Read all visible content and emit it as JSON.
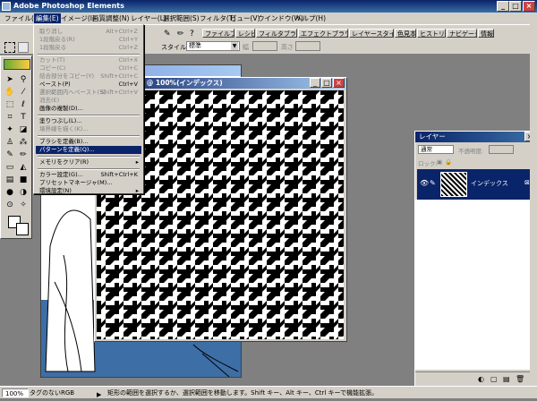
{
  "app": {
    "title": "Adobe Photoshop Elements"
  },
  "window_buttons": {
    "minimize": "_",
    "maximize": "□",
    "close": "×"
  },
  "menubar": [
    "ファイル(F)",
    "編集(E)",
    "イメージ(I)",
    "画質調整(N)",
    "レイヤー(L)",
    "選択範囲(S)",
    "フィルタ(T)",
    "ビュー(V)",
    "ウインドウ(W)",
    "ヘルプ(H)"
  ],
  "options": {
    "style_label": "スタイル",
    "style_value": "標準",
    "width_label": "幅",
    "height_label": "高さ",
    "tabs": [
      "ファイルブラウザ",
      "レシピ",
      "フィルタブラウザ",
      "エフェクトブラウザ",
      "レイヤースタイル",
      "色見本",
      "ヒストリー",
      "ナビゲータ",
      "情報"
    ]
  },
  "edit_menu": {
    "items": [
      {
        "label": "取り消し",
        "shortcut": "Alt+Ctrl+Z",
        "disabled": true
      },
      {
        "label": "1段階戻る(R)",
        "shortcut": "Ctrl+Y",
        "disabled": true
      },
      {
        "label": "1段階戻る",
        "shortcut": "Ctrl+Z",
        "disabled": true
      },
      {
        "sep": true
      },
      {
        "label": "カット(T)",
        "shortcut": "Ctrl+X",
        "disabled": true
      },
      {
        "label": "コピー(C)",
        "shortcut": "Ctrl+C",
        "disabled": true
      },
      {
        "label": "結合部分をコピー(Y)",
        "shortcut": "Shift+Ctrl+C",
        "disabled": true
      },
      {
        "label": "ペースト(P)",
        "shortcut": "Ctrl+V",
        "disabled": false
      },
      {
        "label": "選択範囲内へペースト(S)",
        "shortcut": "Shift+Ctrl+V",
        "disabled": true
      },
      {
        "label": "消去(E)",
        "shortcut": "",
        "disabled": true
      },
      {
        "label": "画像の複製(D)...",
        "shortcut": "",
        "disabled": false
      },
      {
        "sep": true
      },
      {
        "label": "塗りつぶし(L)...",
        "shortcut": "",
        "disabled": false
      },
      {
        "label": "境界線を描く(K)...",
        "shortcut": "",
        "disabled": true
      },
      {
        "sep": true
      },
      {
        "label": "ブラシを定義(B)...",
        "shortcut": "",
        "disabled": false
      },
      {
        "label": "パターンを定義(Q)...",
        "shortcut": "",
        "disabled": false,
        "highlighted": true
      },
      {
        "sep": true
      },
      {
        "label": "メモリをクリア(R)",
        "shortcut": "",
        "disabled": false,
        "submenu": true
      },
      {
        "sep": true
      },
      {
        "label": "カラー設定(G)...",
        "shortcut": "Shift+Ctrl+K",
        "disabled": false
      },
      {
        "label": "プリセットマネージャ(M)...",
        "shortcut": "",
        "disabled": false
      },
      {
        "label": "環境設定(N)",
        "shortcut": "",
        "disabled": false,
        "submenu": true
      }
    ]
  },
  "back_doc": {
    "title": "PSD)"
  },
  "document": {
    "title": "mp @ 100%(インデックス)"
  },
  "layers_panel": {
    "title": "レイヤー",
    "blend_mode": "通常",
    "opacity_label": "不透明度:",
    "lock_label": "ロック:",
    "layer_name": "インデックス"
  },
  "status": {
    "zoom": "100%",
    "mode": "タグのないRGB",
    "message": "矩形の範囲を選択するか、選択範囲を移動します。Shift キー、Alt キー、Ctrl キーで機能拡張。"
  }
}
